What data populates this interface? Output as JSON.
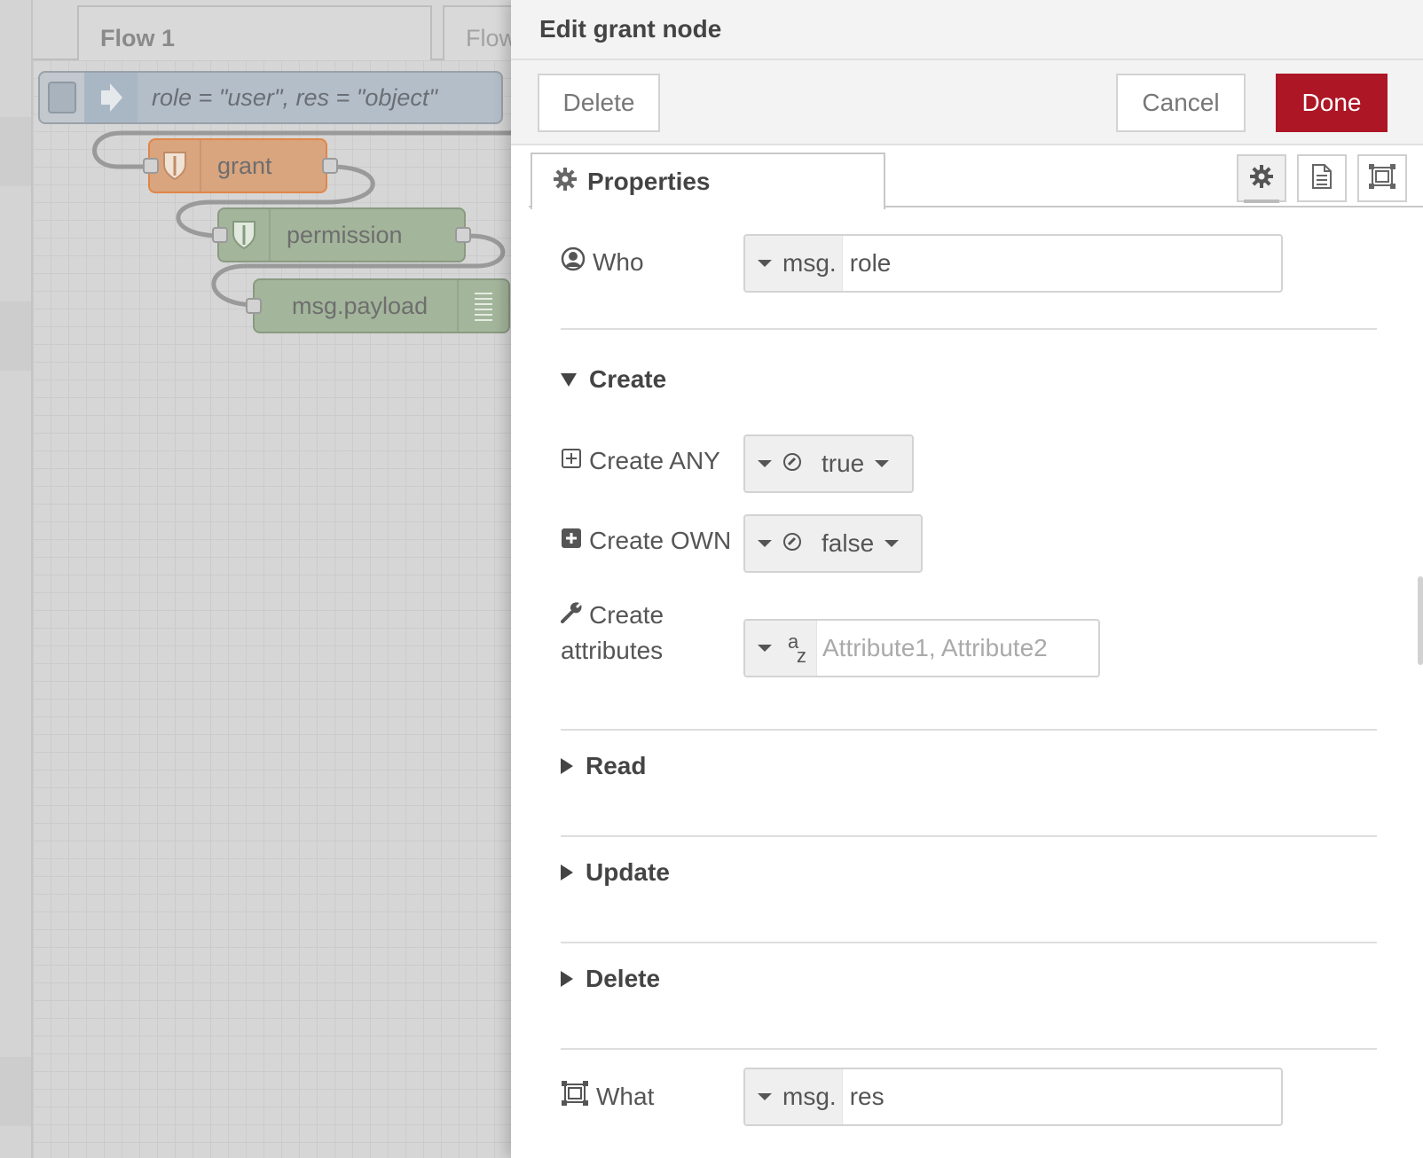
{
  "workspace": {
    "tabs": [
      {
        "label": "Flow 1"
      },
      {
        "label": "Flow"
      }
    ],
    "nodes": {
      "inject": {
        "label": "role = \"user\", res = \"object\"",
        "icon": "arrow-in-icon"
      },
      "grant": {
        "label": "grant",
        "icon": "shield-icon"
      },
      "permission": {
        "label": "permission",
        "icon": "shield-icon"
      },
      "debug": {
        "label": "msg.payload",
        "icon": "list-lines-icon"
      }
    },
    "colors": {
      "inject": "#a6bbcf",
      "grant": "#e2a270",
      "permission": "#8fae83",
      "debug": "#8fae83"
    }
  },
  "tray": {
    "title": "Edit grant node",
    "toolbar": {
      "delete_label": "Delete",
      "cancel_label": "Cancel",
      "done_label": "Done"
    },
    "tabs": {
      "properties_label": "Properties"
    },
    "icons": {
      "settings": "gear-icon",
      "description": "document-icon",
      "appearance": "frame-icon"
    },
    "colors": {
      "done": "#ad1625"
    }
  },
  "form": {
    "who": {
      "label": "Who",
      "type_prefix": "msg.",
      "value": "role"
    },
    "create": {
      "header": "Create",
      "any": {
        "label": "Create ANY",
        "value": "true"
      },
      "own": {
        "label": "Create OWN",
        "value": "false"
      },
      "attributes": {
        "label_line1": "Create",
        "label_line2": "attributes",
        "type_prefix": "a",
        "type_suffix": "z",
        "placeholder": "Attribute1, Attribute2"
      }
    },
    "read": {
      "header": "Read"
    },
    "update": {
      "header": "Update"
    },
    "delete": {
      "header": "Delete"
    },
    "what": {
      "label": "What",
      "type_prefix": "msg.",
      "value": "res"
    }
  }
}
